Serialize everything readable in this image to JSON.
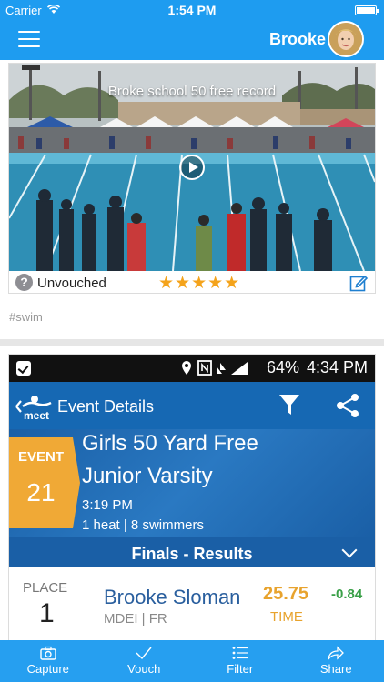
{
  "status_bar": {
    "carrier": "Carrier",
    "time": "1:54 PM"
  },
  "header": {
    "user_name": "Brooke"
  },
  "post1": {
    "video_title": "Broke school 50 free record",
    "vouch_status": "Unvouched",
    "rating_stars": "★★★★★",
    "rating": 5,
    "tag": "#swim"
  },
  "post2": {
    "android_status": {
      "time": "4:34 PM",
      "battery": "64%"
    },
    "meet_app": {
      "header_title": "Event Details",
      "event_label": "EVENT",
      "event_number": "21",
      "event_name_line1": "Girls 50 Yard Free",
      "event_name_line2": "Junior Varsity",
      "event_time": "3:19 PM",
      "heats_info": "1 heat | 8 swimmers",
      "results_title": "Finals - Results",
      "result": {
        "place_label": "PLACE",
        "place": "1",
        "swimmer_name": "Brooke Sloman",
        "team_grade": "MDEI | FR",
        "time": "25.75",
        "time_label": "TIME",
        "diff": "-0.84"
      }
    }
  },
  "tabs": [
    {
      "label": "Capture",
      "icon": "camera-icon"
    },
    {
      "label": "Vouch",
      "icon": "checkmark-icon"
    },
    {
      "label": "Filter",
      "icon": "list-icon"
    },
    {
      "label": "Share",
      "icon": "share-arrow-icon"
    }
  ],
  "colors": {
    "primary": "#1e9cf0",
    "meet_blue": "#1668b3",
    "star": "#f4a31b",
    "event_badge": "#f0a936"
  }
}
